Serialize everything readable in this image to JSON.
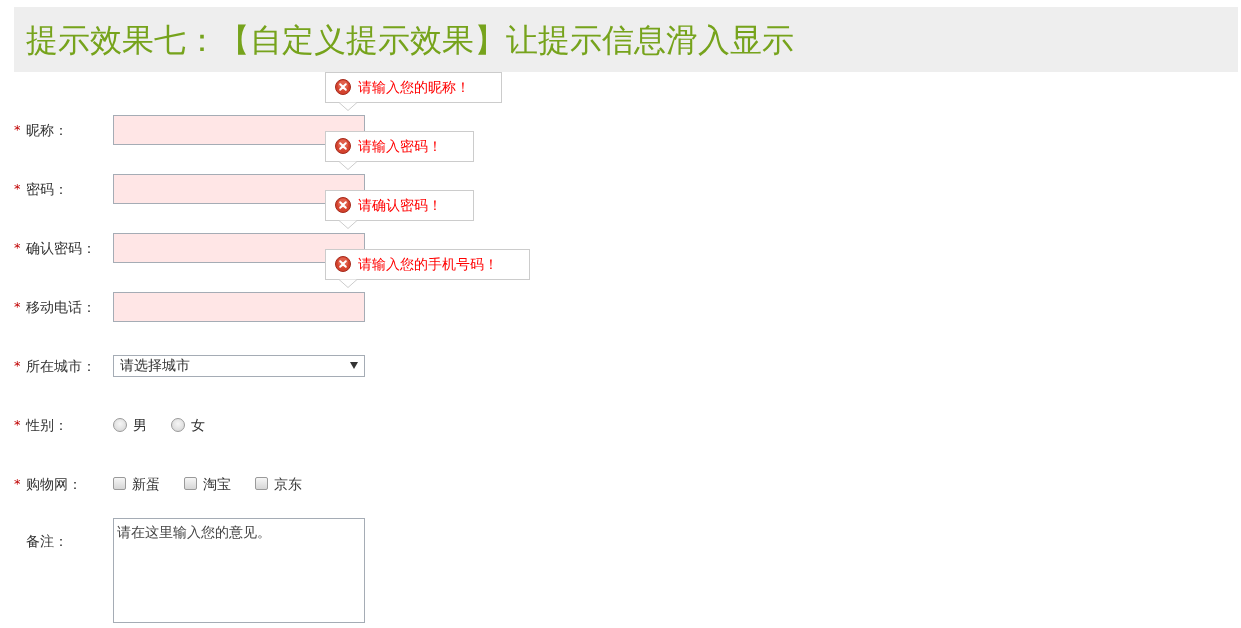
{
  "header": {
    "title": "提示效果七：【自定义提示效果】让提示信息滑入显示"
  },
  "form": {
    "fields": [
      {
        "kind": "text",
        "marker": "*",
        "label": "昵称：",
        "invalid": true,
        "error": "请输入您的昵称！"
      },
      {
        "kind": "text",
        "marker": "*",
        "label": "密码：",
        "invalid": true,
        "error": "请输入密码！"
      },
      {
        "kind": "text",
        "marker": "*",
        "label": "确认密码：",
        "invalid": true,
        "error": "请确认密码！"
      },
      {
        "kind": "text",
        "marker": "*",
        "label": "移动电话：",
        "invalid": true,
        "error": "请输入您的手机号码！"
      },
      {
        "kind": "select",
        "marker": "*",
        "label": "所在城市：",
        "value": "请选择城市"
      },
      {
        "kind": "radio",
        "marker": "*",
        "label": "性别：",
        "options": [
          {
            "label": "男",
            "selected": false
          },
          {
            "label": "女",
            "selected": false
          }
        ]
      },
      {
        "kind": "checkbox",
        "marker": "*",
        "label": "购物网：",
        "options": [
          {
            "label": "新蛋",
            "checked": false
          },
          {
            "label": "淘宝",
            "checked": false
          },
          {
            "label": "京东",
            "checked": false
          }
        ]
      },
      {
        "kind": "textarea",
        "label": "备注：",
        "value": "请在这里输入您的意见。"
      }
    ]
  }
}
